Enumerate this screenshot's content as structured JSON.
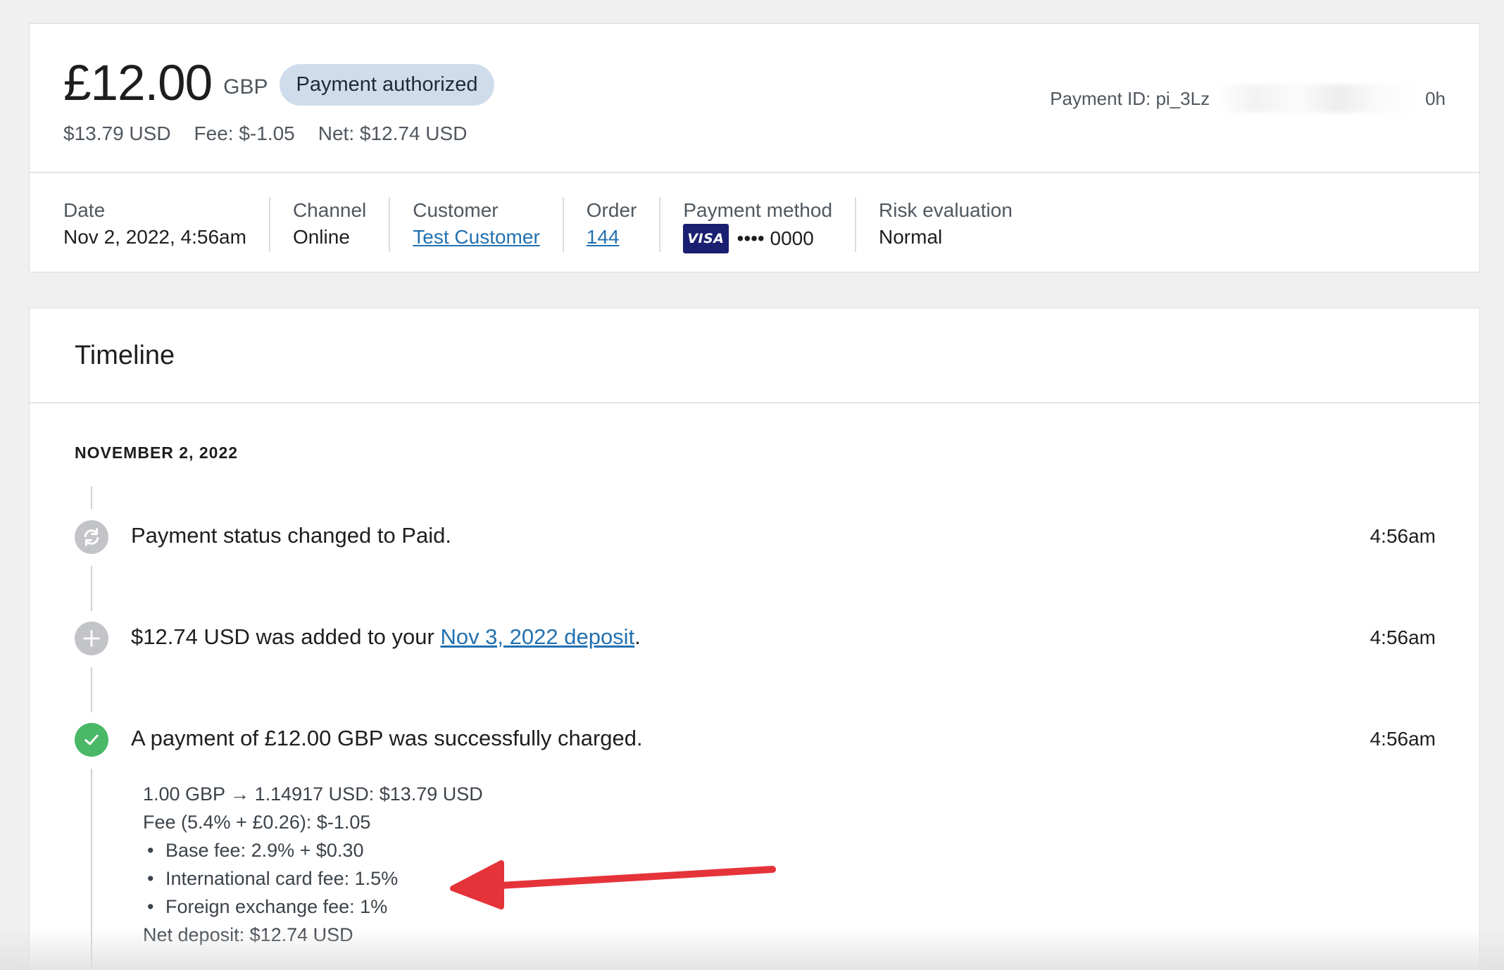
{
  "summary": {
    "amount": "£12.00",
    "currency": "GBP",
    "status": "Payment authorized",
    "usd_amount": "$13.79 USD",
    "fee": "Fee: $-1.05",
    "net": "Net: $12.74 USD",
    "payment_id_prefix": "Payment ID: pi_3Lz",
    "payment_id_suffix": "0h"
  },
  "meta": {
    "date_label": "Date",
    "date_value": "Nov 2, 2022, 4:56am",
    "channel_label": "Channel",
    "channel_value": "Online",
    "customer_label": "Customer",
    "customer_value": "Test Customer",
    "order_label": "Order",
    "order_value": "144",
    "method_label": "Payment method",
    "method_brand": "VISA",
    "method_last4": "•••• 0000",
    "risk_label": "Risk evaluation",
    "risk_value": "Normal"
  },
  "timeline": {
    "title": "Timeline",
    "date_heading": "NOVEMBER 2, 2022",
    "events": [
      {
        "text": "Payment status changed to Paid.",
        "time": "4:56am",
        "icon": "sync-icon"
      },
      {
        "text_before": "$12.74 USD was added to your ",
        "link": "Nov 3, 2022 deposit",
        "text_after": ".",
        "time": "4:56am",
        "icon": "plus-icon"
      },
      {
        "text": "A payment of £12.00 GBP was successfully charged.",
        "time": "4:56am",
        "icon": "checkmark-icon"
      }
    ],
    "details": {
      "conversion": "1.00 GBP → 1.14917 USD: $13.79 USD",
      "fee": "Fee (5.4% + £0.26): $-1.05",
      "bullets": [
        "Base fee: 2.9% + $0.30",
        "International card fee: 1.5%",
        "Foreign exchange fee: 1%"
      ],
      "net_deposit": "Net deposit: $12.74 USD"
    }
  },
  "colors": {
    "status_pill_bg": "#cfdceb",
    "link": "#2271b1",
    "success": "#4ab866",
    "annotation_arrow": "#e5333a"
  }
}
